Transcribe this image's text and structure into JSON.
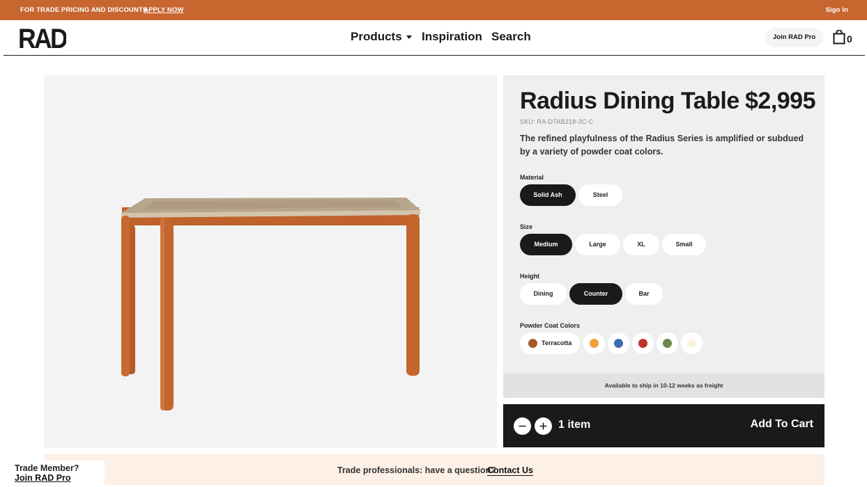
{
  "promo": {
    "text": "FOR TRADE PRICING AND DISCOUNTS",
    "apply_link": "APPLY NOW",
    "sign_in": "Sign In"
  },
  "header": {
    "logo_text": "RAD",
    "nav": [
      "Products",
      "Inspiration",
      "Search"
    ],
    "join_pro": "Join RAD Pro",
    "cart_count": "0"
  },
  "product": {
    "title": "Radius Dining Table",
    "price": "$2,995",
    "sku": "SKU: RA-DTAB218-3C-C",
    "description": "The refined playfulness of the Radius Series is amplified or subdued by a variety of powder coat colors.",
    "options": {
      "material": {
        "label": "Material",
        "values": [
          "Solid Ash",
          "Steel"
        ],
        "selected": "Solid Ash"
      },
      "size": {
        "label": "Size",
        "values": [
          "Medium",
          "Large",
          "XL",
          "Small"
        ],
        "selected": "Medium"
      },
      "height": {
        "label": "Height",
        "values": [
          "Dining",
          "Counter",
          "Bar"
        ],
        "selected": "Counter"
      },
      "colors": {
        "label": "Powder Coat Colors",
        "selected_name": "Terracotta",
        "swatches": [
          "#a65a28",
          "#f2a03a",
          "#3a6fb0",
          "#c1312d",
          "#6e8748",
          "#fbf3dd"
        ]
      }
    },
    "shipping": "Available to ship in 10-12 weeks as freight",
    "quantity_label": "1 item",
    "add_to_cart": "Add To Cart"
  },
  "trade": {
    "question": "Trade professionals: have a question?",
    "contact": "Contact Us",
    "member_title": "Trade Member?",
    "member_link": "Join RAD Pro"
  },
  "colors": {
    "promo_bg": "#c7662f",
    "table_leg": "#c0622b",
    "panel_bg": "#efefef",
    "dark": "#1a1a1a"
  }
}
